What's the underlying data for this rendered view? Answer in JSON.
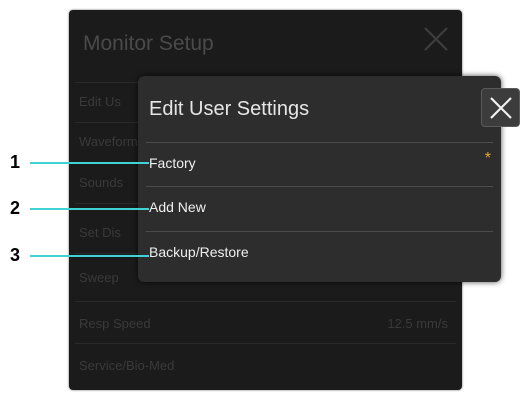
{
  "background_window": {
    "title": "Monitor Setup",
    "rows": [
      {
        "label": "Edit Us",
        "value": ""
      },
      {
        "label": "Waveform",
        "value": ""
      },
      {
        "label": "Sounds",
        "value": ""
      },
      {
        "label": "Set Dis",
        "value": ""
      },
      {
        "label": "Sweep",
        "value": ""
      },
      {
        "label": "Resp Speed",
        "value": "12.5 mm/s"
      },
      {
        "label": "Service/Bio-Med",
        "value": ""
      }
    ]
  },
  "popup": {
    "title": "Edit User Settings",
    "items": [
      {
        "label": "Factory",
        "starred": true,
        "star": "*"
      },
      {
        "label": "Add New",
        "starred": false,
        "star": ""
      },
      {
        "label": "Backup/Restore",
        "starred": false,
        "star": ""
      }
    ]
  },
  "callouts": [
    "1",
    "2",
    "3"
  ],
  "colors": {
    "callout_line": "#3fd3d6",
    "star": "#e8a53a",
    "popup_bg": "#2d2d2d",
    "background_window_bg": "#1b1b1b"
  },
  "icons": {
    "background_close": "close-icon",
    "popup_close": "close-icon"
  }
}
